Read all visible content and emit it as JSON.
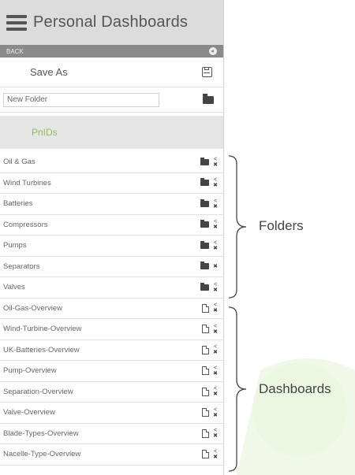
{
  "header": {
    "title": "Personal Dashboards",
    "menu_icon": "hamburger-menu-icon"
  },
  "back_bar": {
    "label": "BACK",
    "icon": "back-arrow-icon"
  },
  "save_as": {
    "label": "Save As",
    "icon": "floppy-disk-icon"
  },
  "new_folder": {
    "placeholder": "New Folder",
    "icon": "add-folder-icon"
  },
  "section": {
    "label": "PnIDs",
    "color": "#8bc34a"
  },
  "folders": [
    {
      "label": "Oil & Gas"
    },
    {
      "label": "Wind Turbines"
    },
    {
      "label": "Batteries"
    },
    {
      "label": "Compressors"
    },
    {
      "label": "Pumps"
    },
    {
      "label": "Separators"
    },
    {
      "label": "Valves"
    }
  ],
  "dashboards": [
    {
      "label": "Oil-Gas-Overview"
    },
    {
      "label": "Wind-Turbine-Overview"
    },
    {
      "label": "UK-Batteries-Overview"
    },
    {
      "label": "Pump-Overview"
    },
    {
      "label": "Separation-Overview"
    },
    {
      "label": "Valve-Overview"
    },
    {
      "label": "Blade-Types-Overview"
    },
    {
      "label": "Nacelle-Type-Overview"
    }
  ],
  "annotations": {
    "folders": "Folders",
    "dashboards": "Dashboards"
  },
  "row_action_glyphs": {
    "close": "✖",
    "share": "<"
  }
}
